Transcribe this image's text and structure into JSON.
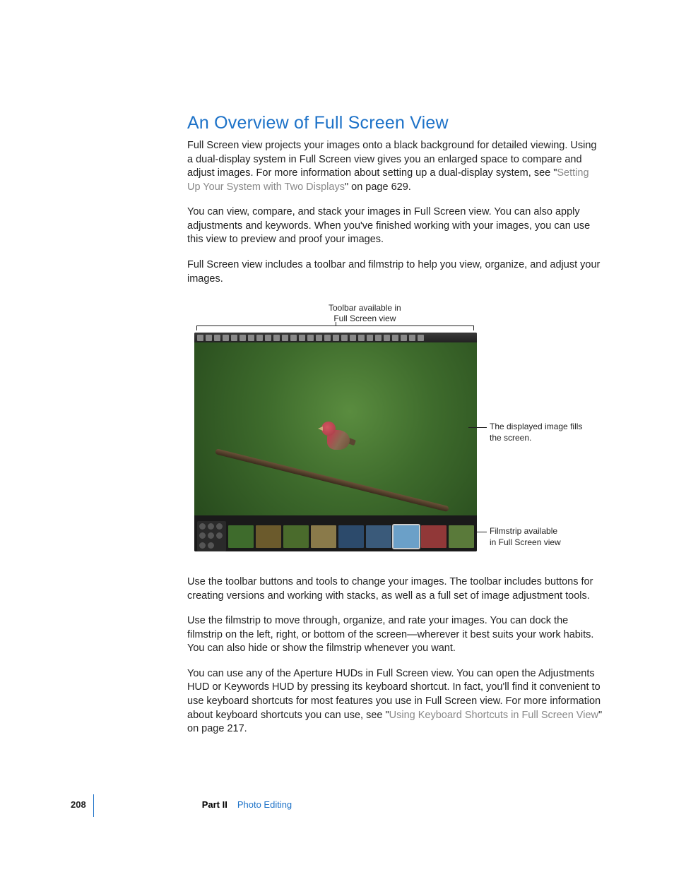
{
  "heading": "An Overview of Full Screen View",
  "para1_a": "Full Screen view projects your images onto a black background for detailed viewing. Using a dual-display system in Full Screen view gives you an enlarged space to compare and adjust images. For more information about setting up a dual-display system, see \"",
  "para1_link": "Setting Up Your System with Two Displays",
  "para1_b": "\" on page 629.",
  "para2": "You can view, compare, and stack your images in Full Screen view. You can also apply adjustments and keywords. When you've finished working with your images, you can use this view to preview and proof your images.",
  "para3": "Full Screen view includes a toolbar and filmstrip to help you view, organize, and adjust your images.",
  "callout_top_l1": "Toolbar available in",
  "callout_top_l2": "Full Screen view",
  "callout_mid_l1": "The displayed image fills",
  "callout_mid_l2": "the screen.",
  "callout_bot_l1": "Filmstrip available",
  "callout_bot_l2": "in Full Screen view",
  "para4": "Use the toolbar buttons and tools to change your images. The toolbar includes buttons for creating versions and working with stacks, as well as a full set of image adjustment tools.",
  "para5": "Use the filmstrip to move through, organize, and rate your images. You can dock the filmstrip on the left, right, or bottom of the screen—wherever it best suits your work habits. You can also hide or show the filmstrip whenever you want.",
  "para6_a": "You can use any of the Aperture HUDs in Full Screen view. You can open the Adjustments HUD or Keywords HUD by pressing its keyboard shortcut. In fact, you'll find it convenient to use keyboard shortcuts for most features you use in Full Screen view. For more information about keyboard shortcuts you can use, see \"",
  "para6_link": "Using Keyboard Shortcuts in Full Screen View",
  "para6_b": "\" on page 217.",
  "footer": {
    "page": "208",
    "part": "Part II",
    "section": "Photo Editing"
  },
  "thumbs": [
    "#3e6b2c",
    "#6b5a2c",
    "#4a6b2c",
    "#8a7a4a",
    "#2c4a6b",
    "#3a5a7a",
    "#6ba0c8",
    "#913838",
    "#5a7a3a"
  ]
}
